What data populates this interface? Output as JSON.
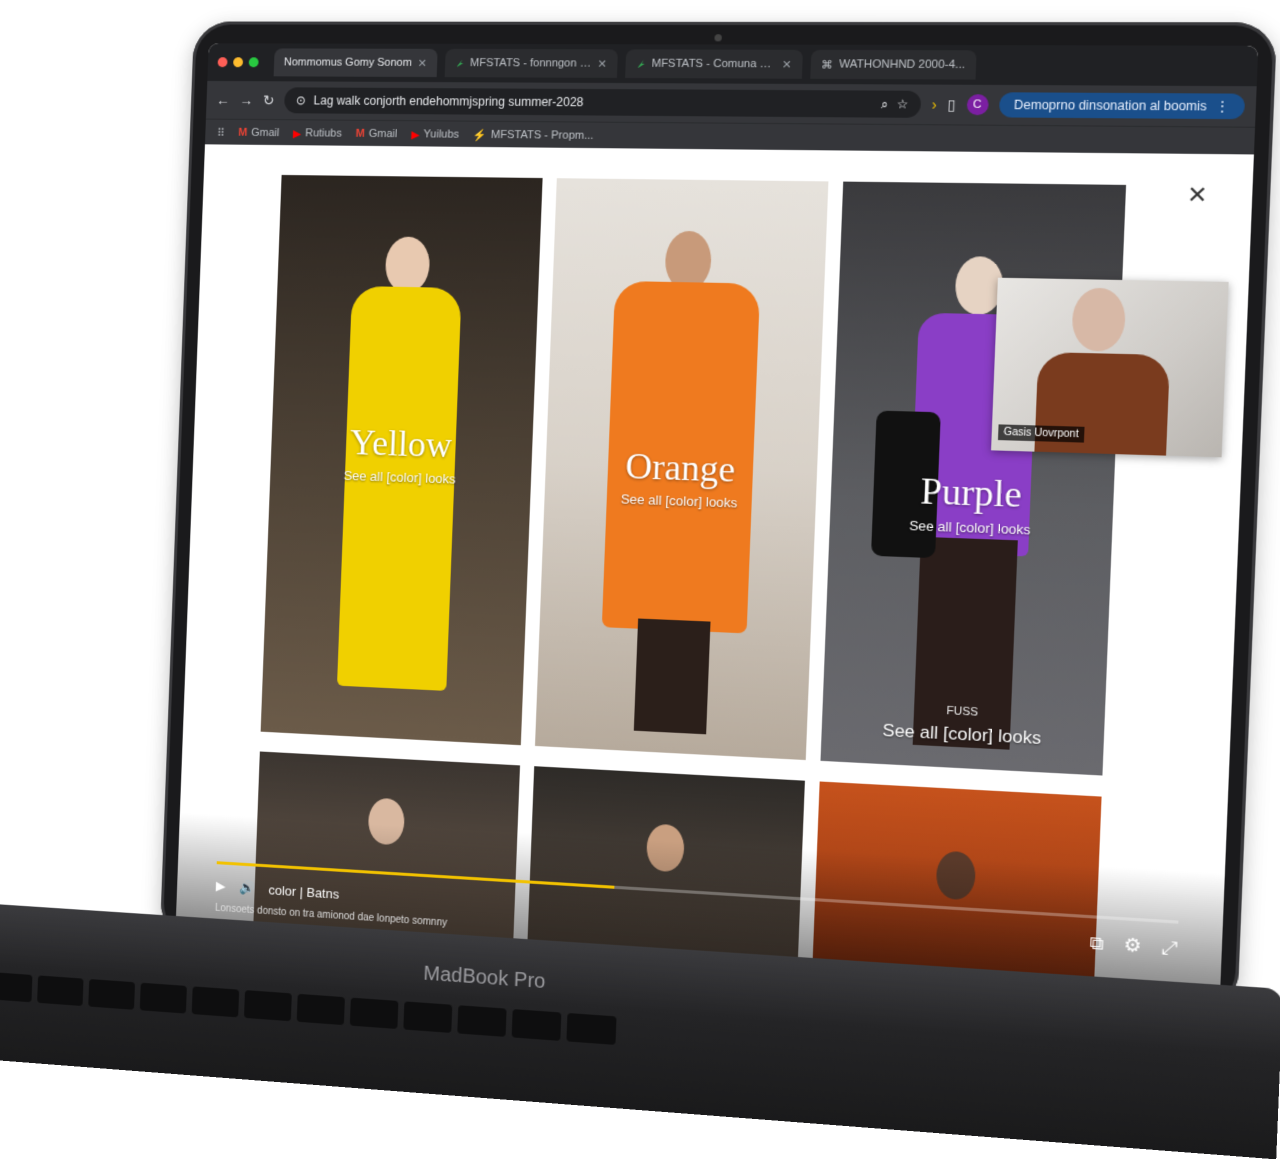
{
  "browser": {
    "tabs": [
      {
        "title": "Nommomus Gomy Sonom",
        "active": true
      },
      {
        "title": "MFSTATS - fonnngon - Wid"
      },
      {
        "title": "MFSTATS - Comuna Xom"
      },
      {
        "title": "WATHONHND 2000-4..."
      }
    ],
    "url": "Lag walk conjorth endehommjspring summer-2028",
    "profile_initial": "C",
    "pill_label": "Demoprno dinsonation al boomis",
    "bookmarks": [
      "Gmail",
      "Rutiubs",
      "Gmail",
      "Yuilubs",
      "MFSTATS - Propm..."
    ]
  },
  "page": {
    "cards": [
      {
        "title": "Yellow",
        "link": "See all [color] looks",
        "accent": "#f0d000"
      },
      {
        "title": "Orange",
        "link": "See all [color] looks",
        "accent": "#ef7a1f"
      },
      {
        "title": "Purple",
        "link": "See all [color] looks",
        "extra_label": "FUSS",
        "extra_link": "See all [color] looks",
        "accent": "#8a3ec6"
      }
    ]
  },
  "video": {
    "label": "color | Batns",
    "progress": 0.43,
    "subtitle": "Lonsoets donsto on tra amionod dae lonpeto somnny"
  },
  "pip": {
    "name": "Gasis Uovrpont"
  },
  "laptop": {
    "brand": "MadBook Pro"
  }
}
